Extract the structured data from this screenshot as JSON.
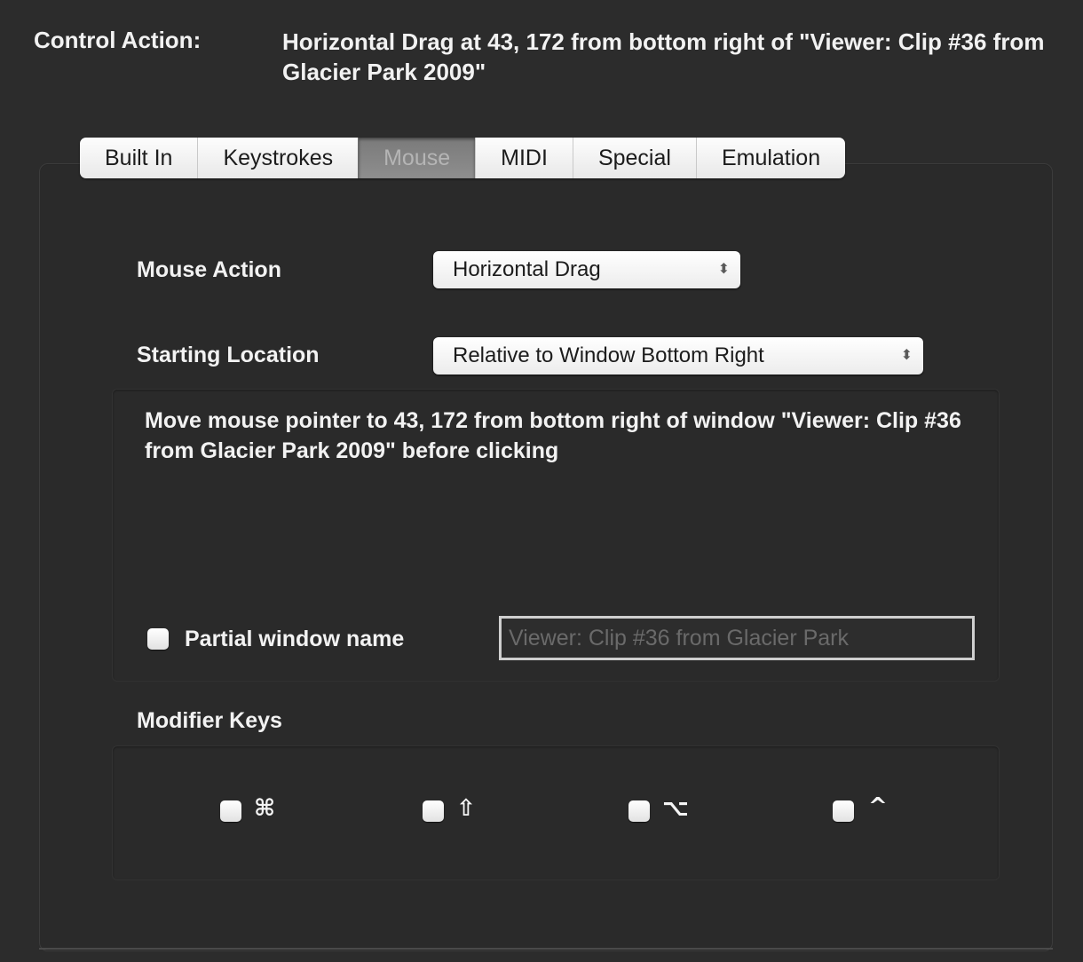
{
  "control_action": {
    "label": "Control Action:",
    "value": "Horizontal Drag at 43, 172 from bottom right of \"Viewer: Clip #36 from Glacier Park 2009\""
  },
  "tabs": [
    {
      "label": "Built In",
      "active": false
    },
    {
      "label": "Keystrokes",
      "active": false
    },
    {
      "label": "Mouse",
      "active": true
    },
    {
      "label": "MIDI",
      "active": false
    },
    {
      "label": "Special",
      "active": false
    },
    {
      "label": "Emulation",
      "active": false
    }
  ],
  "mouse_action": {
    "label": "Mouse Action",
    "selected": "Horizontal Drag",
    "arrows": "⬍"
  },
  "starting_location": {
    "label": "Starting Location",
    "selected": "Relative to Window Bottom Right",
    "arrows": "⬍"
  },
  "description": "Move mouse pointer to 43, 172 from bottom right of window \"Viewer: Clip #36 from Glacier Park 2009\" before clicking",
  "partial_window": {
    "label": "Partial window name",
    "checked": false,
    "field_value": "Viewer: Clip #36 from Glacier Park"
  },
  "modifier_keys": {
    "label": "Modifier Keys",
    "keys": [
      {
        "symbol": "⌘",
        "name": "command",
        "checked": false
      },
      {
        "symbol": "⇧",
        "name": "shift",
        "checked": false
      },
      {
        "symbol": "⌥",
        "name": "option",
        "checked": false
      },
      {
        "symbol": "^",
        "name": "control",
        "checked": false
      }
    ]
  }
}
